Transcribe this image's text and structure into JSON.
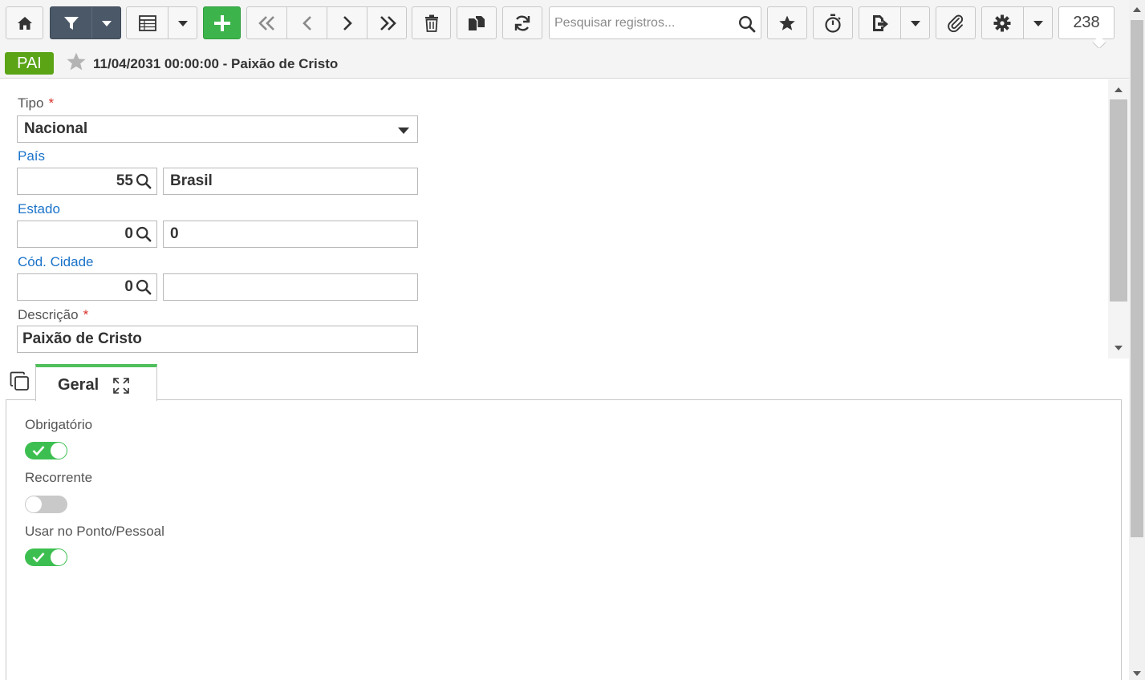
{
  "toolbar": {
    "search_placeholder": "Pesquisar registros...",
    "record_count": "238"
  },
  "record": {
    "badge": "PAI",
    "title": "11/04/2031 00:00:00 - Paixão de Cristo"
  },
  "form": {
    "tipo": {
      "label": "Tipo",
      "required_mark": "*",
      "value": "Nacional"
    },
    "pais": {
      "label": "País",
      "code": "55",
      "name": "Brasil"
    },
    "estado": {
      "label": "Estado",
      "code": "0",
      "name": "0"
    },
    "cidade": {
      "label": "Cód. Cidade",
      "code": "0",
      "name": ""
    },
    "descricao": {
      "label": "Descrição",
      "required_mark": "*",
      "value": "Paixão de Cristo"
    }
  },
  "tabs": [
    {
      "label": "Geral"
    }
  ],
  "geral": {
    "obrigatorio": {
      "label": "Obrigatório",
      "on": true
    },
    "recorrente": {
      "label": "Recorrente",
      "on": false
    },
    "usar_ponto": {
      "label": "Usar no Ponto/Pessoal",
      "on": true
    }
  },
  "colors": {
    "badge_green": "#5aa416",
    "add_green": "#3cb44b",
    "toggle_on": "#3cbf50",
    "toggle_off": "#c9c9c9",
    "tab_accent": "#4fbf5c",
    "link_blue": "#1a73c9",
    "required_red": "#d9312b",
    "filter_dark": "#4a5868"
  },
  "icons": [
    "home-icon",
    "filter-icon",
    "chevron-down-icon",
    "grid-view-icon",
    "plus-icon",
    "first-record-icon",
    "previous-record-icon",
    "next-record-icon",
    "last-record-icon",
    "trash-icon",
    "copy-documents-icon",
    "refresh-icon",
    "search-icon",
    "star-icon",
    "stopwatch-icon",
    "export-icon",
    "paperclip-icon",
    "gear-icon",
    "copy-icon",
    "expand-icon",
    "check-icon"
  ]
}
